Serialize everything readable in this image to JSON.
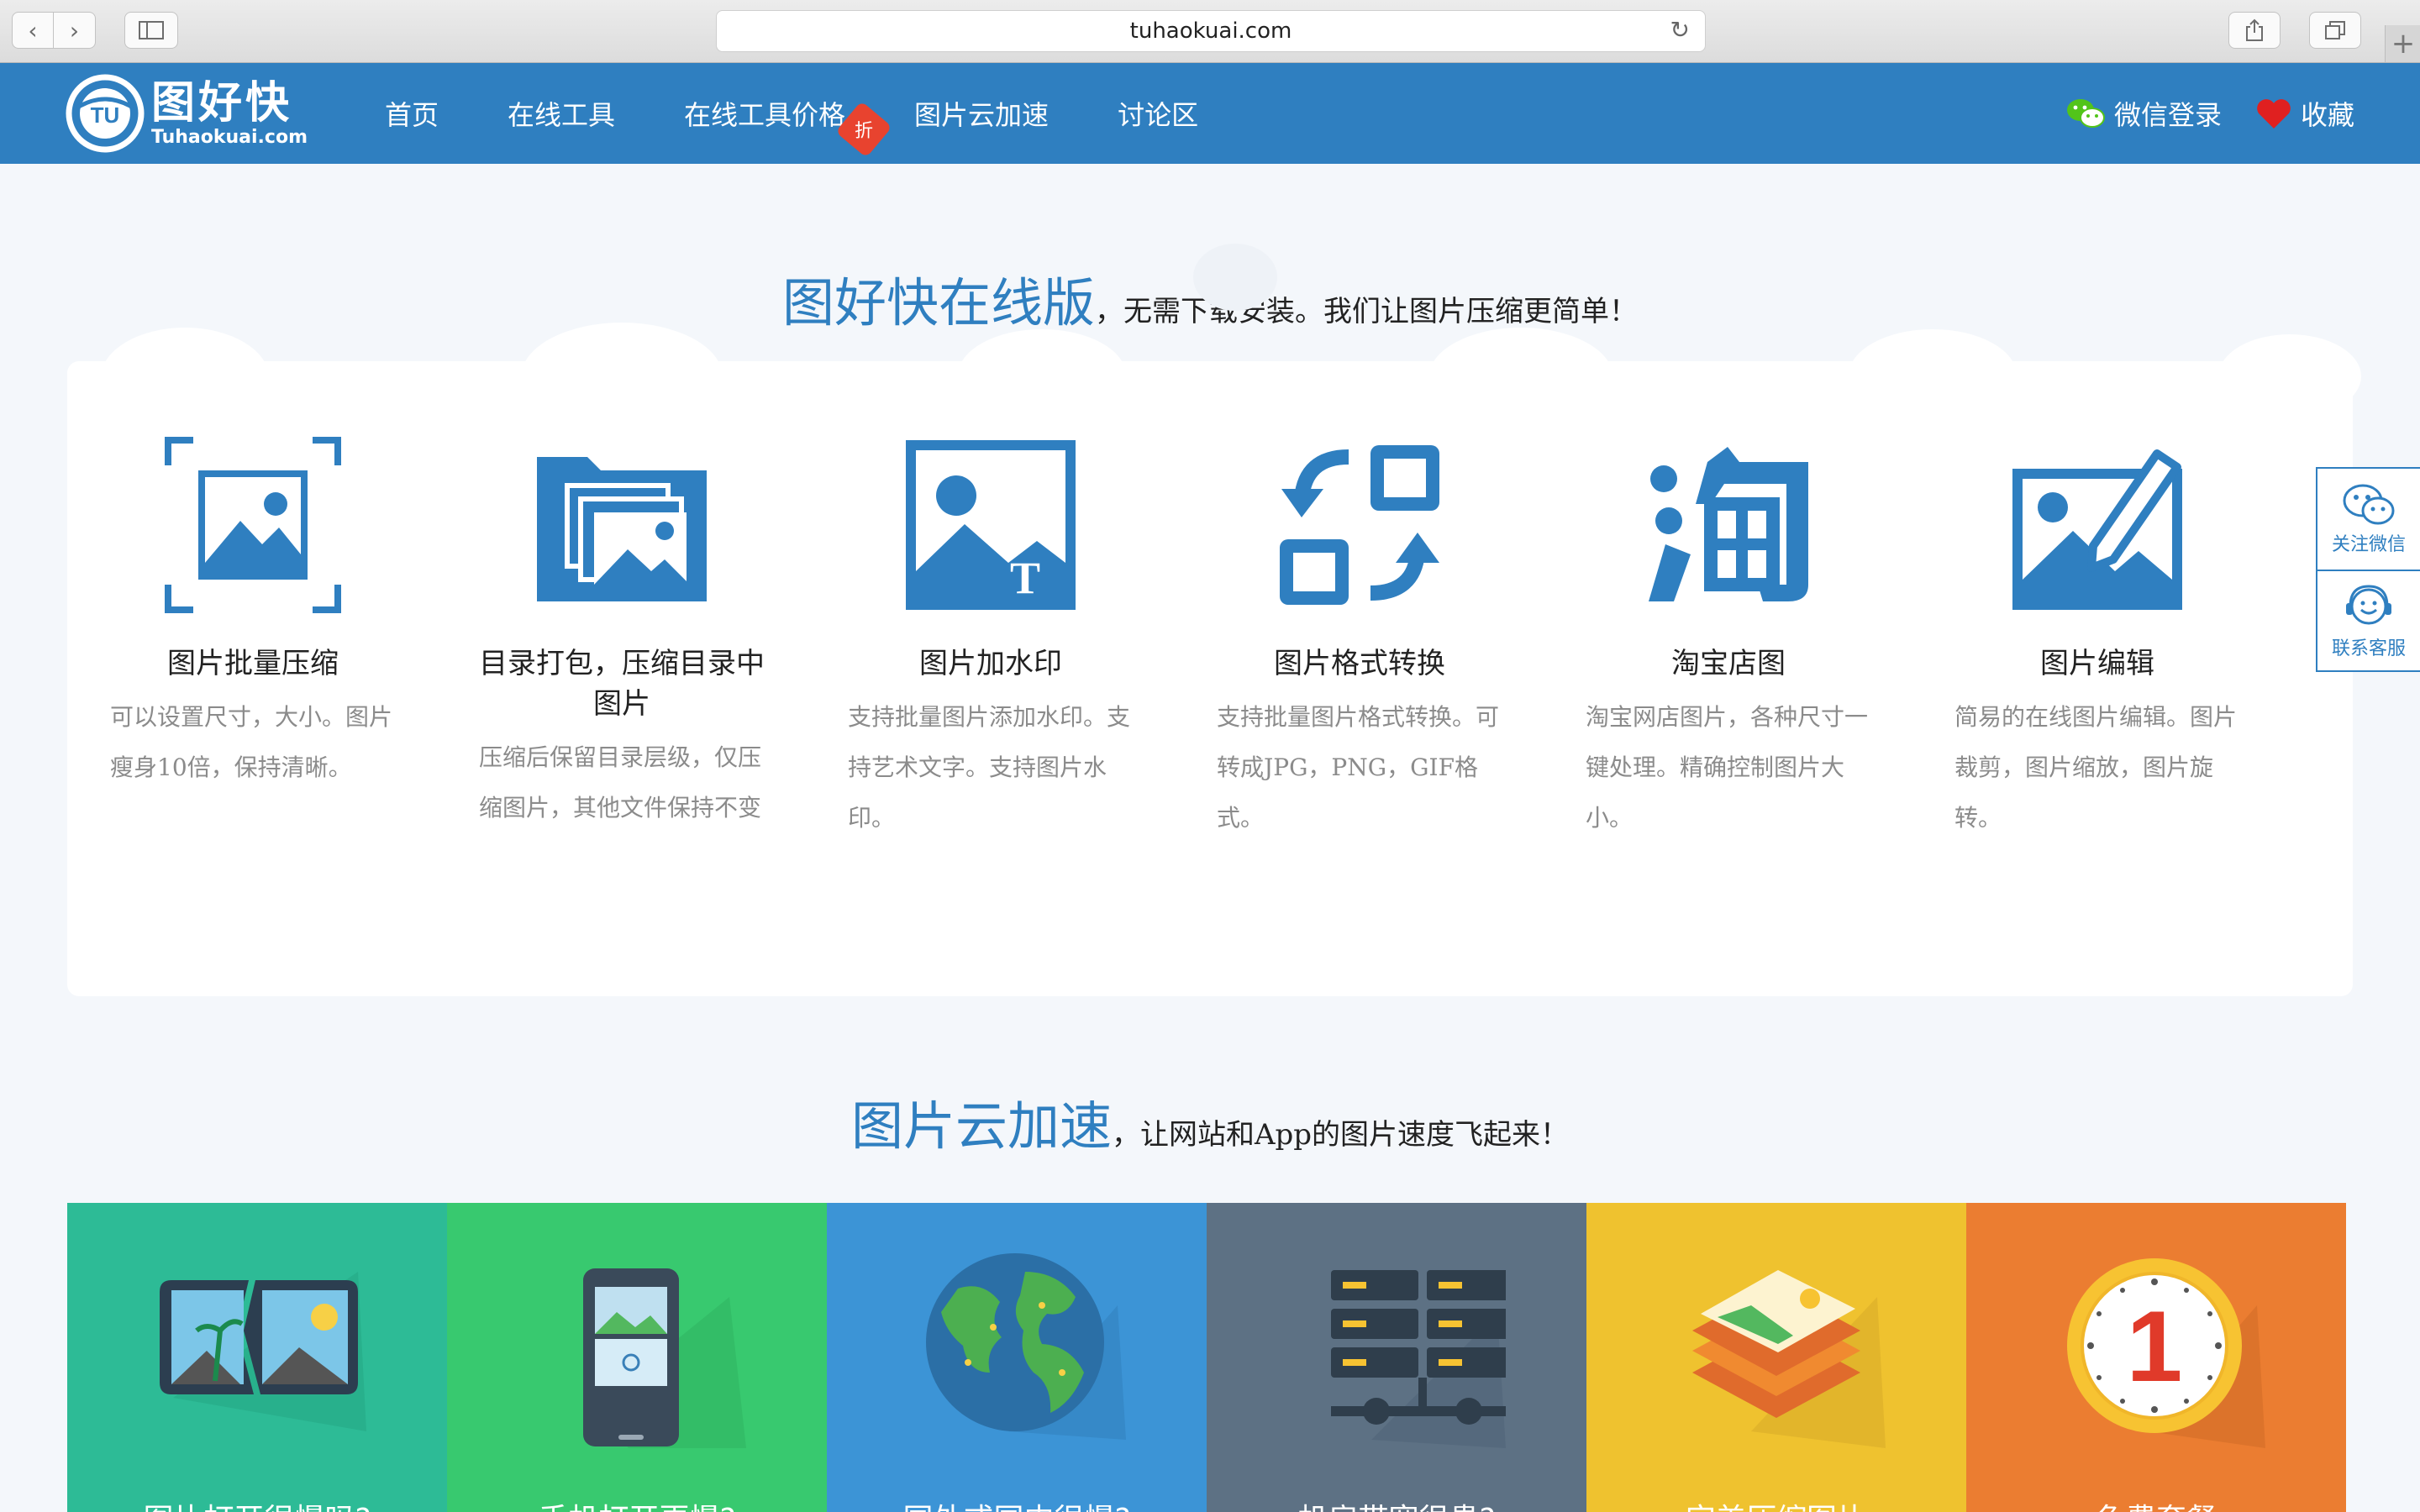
{
  "browser": {
    "url": "tuhaokuai.com"
  },
  "header": {
    "logo_cn": "图好快",
    "logo_en": "Tuhaokuai.com",
    "nav": [
      "首页",
      "在线工具",
      "在线工具价格",
      "图片云加速",
      "讨论区"
    ],
    "discount_tag": "折",
    "wechat_login": "微信登录",
    "favorite": "收藏",
    "brand_color": "#2f7fc0"
  },
  "section1": {
    "title": "图好快在线版",
    "subtitle": "，无需下载安装。我们让图片压缩更简单！",
    "features": [
      {
        "icon": "batch-compress-icon",
        "title": "图片批量压缩",
        "desc": "可以设置尺寸，大小。图片瘦身10倍，保持清晰。"
      },
      {
        "icon": "folder-pack-icon",
        "title": "目录打包，压缩目录中图片",
        "desc": "压缩后保留目录层级，仅压缩图片，其他文件保持不变"
      },
      {
        "icon": "watermark-icon",
        "title": "图片加水印",
        "desc": "支持批量图片添加水印。支持艺术文字。支持图片水印。"
      },
      {
        "icon": "format-convert-icon",
        "title": "图片格式转换",
        "desc": "支持批量图片格式转换。可转成JPG，PNG，GIF格式。"
      },
      {
        "icon": "taobao-icon",
        "title": "淘宝店图",
        "desc": "淘宝网店图片，各种尺寸一键处理。精确控制图片大小。"
      },
      {
        "icon": "image-edit-icon",
        "title": "图片编辑",
        "desc": "简易的在线图片编辑。图片裁剪，图片缩放，图片旋转。"
      }
    ]
  },
  "section2": {
    "title": "图片云加速",
    "subtitle": "，让网站和App的图片速度飞起来！",
    "tiles": [
      {
        "icon": "broken-photo-icon",
        "color": "#2dbb96",
        "label": "图片打开很慢吗?"
      },
      {
        "icon": "phone-icon",
        "color": "#38c96f",
        "label": "手机打开更慢?"
      },
      {
        "icon": "globe-icon",
        "color": "#3c94d6",
        "label": "国外或国内很慢?"
      },
      {
        "icon": "server-icon",
        "color": "#5d7184",
        "label": "机房带宽很贵?"
      },
      {
        "icon": "layers-icon",
        "color": "#efc22f",
        "label": "完美压缩图片"
      },
      {
        "icon": "clock-icon",
        "color": "#eb7d31",
        "label": "免费套餐"
      }
    ]
  },
  "side": {
    "follow_wechat": "关注微信",
    "contact_service": "联系客服"
  }
}
